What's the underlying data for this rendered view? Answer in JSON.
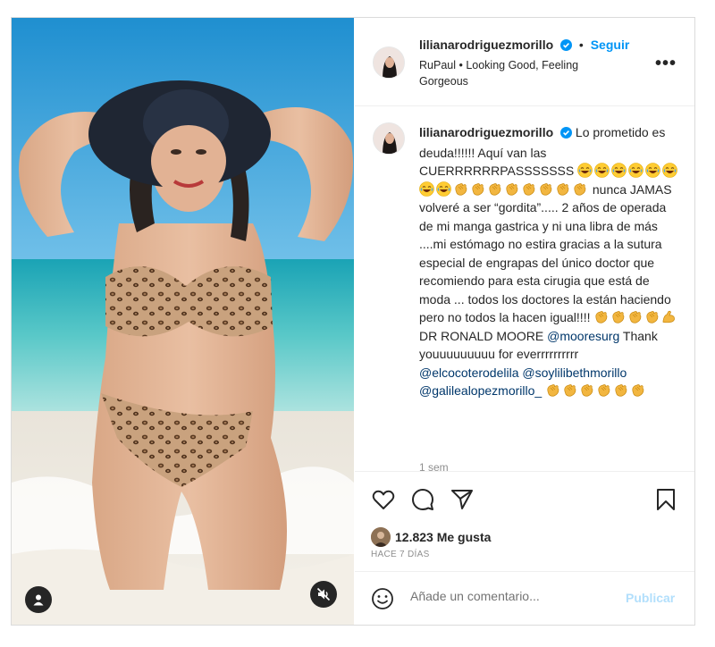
{
  "post": {
    "username": "lilianarodriguezmorillo",
    "follow_label": "Seguir",
    "separator": "•",
    "audio": "RuPaul • Looking Good, Feeling Gorgeous",
    "more_icon": "more-horizontal-icon",
    "verified_icon": "verified-badge-icon"
  },
  "caption": {
    "username": "lilianarodriguezmorillo",
    "text_1": "Lo prometido es deuda!!!!!! Aquí van las CUERRRRRRPASSSSSSS",
    "text_2": "nunca JAMAS volveré a ser “gordita”..... 2 años de operada de mi manga gastrica y ni una libra de más ....mi estómago no estira gracias a la sutura especial de engrapas del único doctor que recomiendo para esta cirugia que está de moda ... todos los doctores la están haciendo pero no todos la hacen igual!!!!",
    "text_3": "DR RONALD MOORE",
    "mention_1": "@mooresurg",
    "text_4": "Thank youuuuuuuuu for everrrrrrrrrr",
    "mention_2": "@elcocoterodelila",
    "mention_3": "@soylilibethmorillo",
    "mention_4": "@galilealopezmorillo_",
    "time": "1 sem",
    "emoji_names": [
      "laughing-emoji",
      "clapping-emoji",
      "flexed-biceps-emoji"
    ]
  },
  "actions": {
    "icons": [
      "heart-icon",
      "comment-icon",
      "share-icon",
      "bookmark-icon"
    ],
    "likes": "12.823 Me gusta",
    "date": "HACE 7 DÍAS"
  },
  "comment": {
    "placeholder": "Añade un comentario...",
    "publish_label": "Publicar"
  },
  "media": {
    "user_tag_icon": "user-tag-icon",
    "mute_icon": "muted-speaker-icon"
  },
  "colors": {
    "accent": "#0095f6",
    "publish_disabled": "#b2dffc",
    "text": "#262626",
    "muted": "#8e8e8e",
    "mention": "#00376b"
  }
}
